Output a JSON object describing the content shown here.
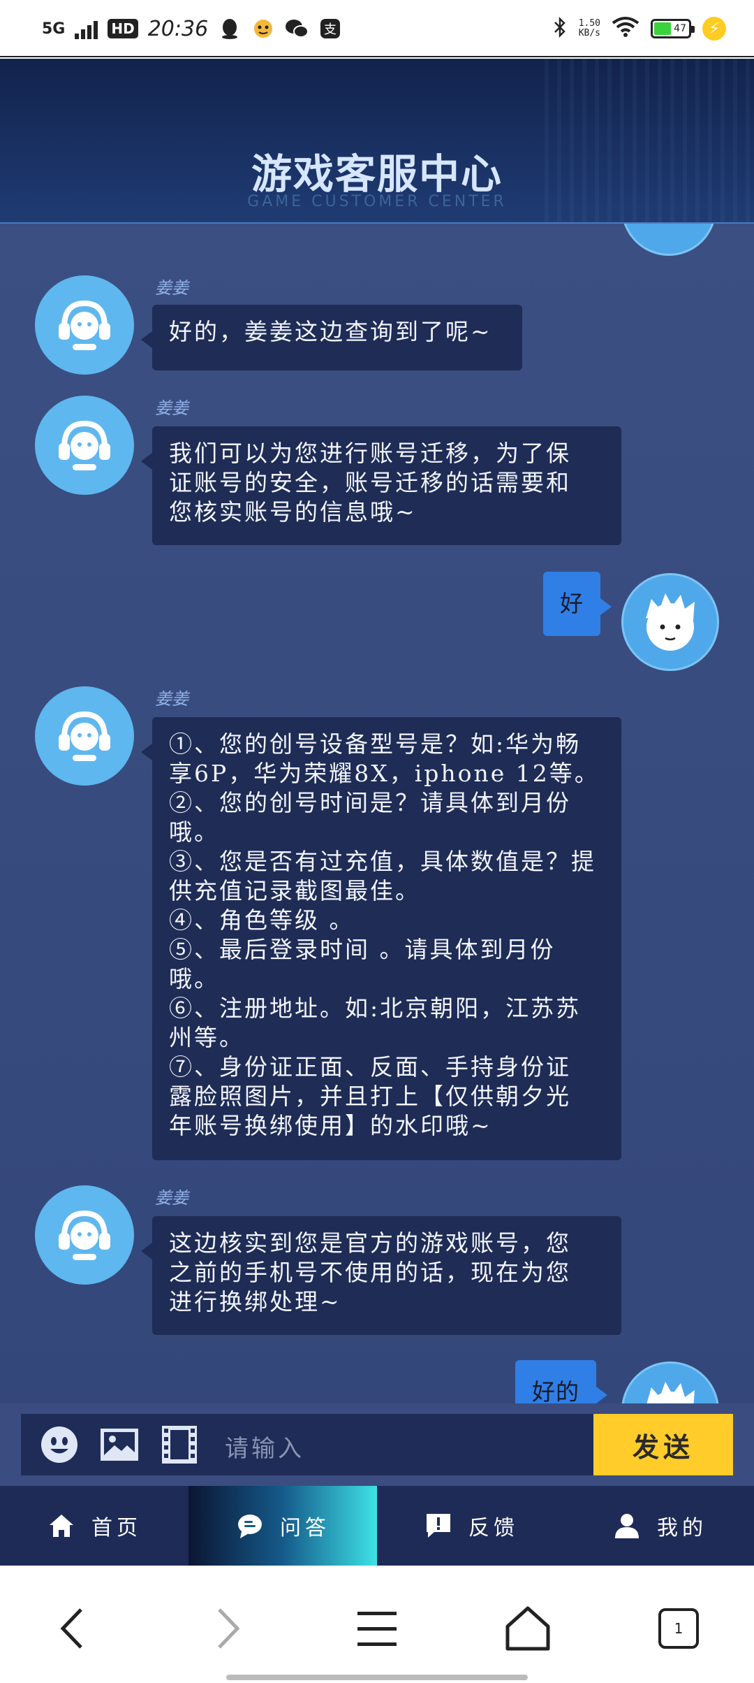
{
  "status_bar": {
    "network": "5G",
    "hd": "HD",
    "time": "20:36",
    "speed_value": "1.50",
    "speed_unit": "KB/s",
    "battery": "47",
    "battery_level": 0.47,
    "icons": [
      "qq-icon",
      "mascot-icon",
      "wechat-icon",
      "app-icon",
      "bluetooth-icon",
      "wifi-icon",
      "charging-icon"
    ]
  },
  "header": {
    "title": "游戏客服中心",
    "subtitle": "GAME CUSTOMER CENTER"
  },
  "messages": [
    {
      "from": "agent",
      "sender": "姜姜",
      "text": "好的，姜姜这边查询到了呢~"
    },
    {
      "from": "agent",
      "sender": "姜姜",
      "lines": [
        "我们可以为您进行账号迁移，为了保",
        "证账号的安全，账号迁移的话需要和",
        "您核实账号的信息哦~"
      ]
    },
    {
      "from": "user",
      "text": "好"
    },
    {
      "from": "agent",
      "sender": "姜姜",
      "lines": [
        "①、您的创号设备型号是？如:华为畅",
        "享6P，华为荣耀8X，iphone 12等。",
        "②、您的创号时间是？请具体到月份",
        "哦。",
        "③、您是否有过充值，具体数值是？提",
        "供充值记录截图最佳。",
        "④、角色等级 。",
        "⑤、最后登录时间 。请具体到月份",
        "哦。",
        "⑥、注册地址。如:北京朝阳，江苏苏",
        "州等。",
        "⑦、身份证正面、反面、手持身份证",
        "露脸照图片，并且打上【仅供朝夕光",
        "年账号换绑使用】的水印哦~"
      ]
    },
    {
      "from": "agent",
      "sender": "姜姜",
      "lines": [
        "这边核实到您是官方的游戏账号，您",
        "之前的手机号不使用的话，现在为您",
        "进行换绑处理~"
      ]
    },
    {
      "from": "user",
      "text": "好的"
    }
  ],
  "input": {
    "placeholder": "请输入",
    "send_label": "发送"
  },
  "bottom_nav": [
    {
      "label": "首页",
      "icon": "home-icon",
      "active": false
    },
    {
      "label": "问答",
      "icon": "chat-icon",
      "active": true
    },
    {
      "label": "反馈",
      "icon": "feedback-icon",
      "active": false
    },
    {
      "label": "我的",
      "icon": "user-icon",
      "active": false
    }
  ],
  "browser_nav": {
    "tab_count": "1"
  },
  "colors": {
    "header_bg": "#12234c",
    "chat_bg": "#3b4f82",
    "agent_bubble": "#1e2c56",
    "user_bubble": "#2f7fe6",
    "avatar": "#5fb7ef",
    "send_button": "#ffcc2a",
    "nav_active": "#3de2e6"
  }
}
